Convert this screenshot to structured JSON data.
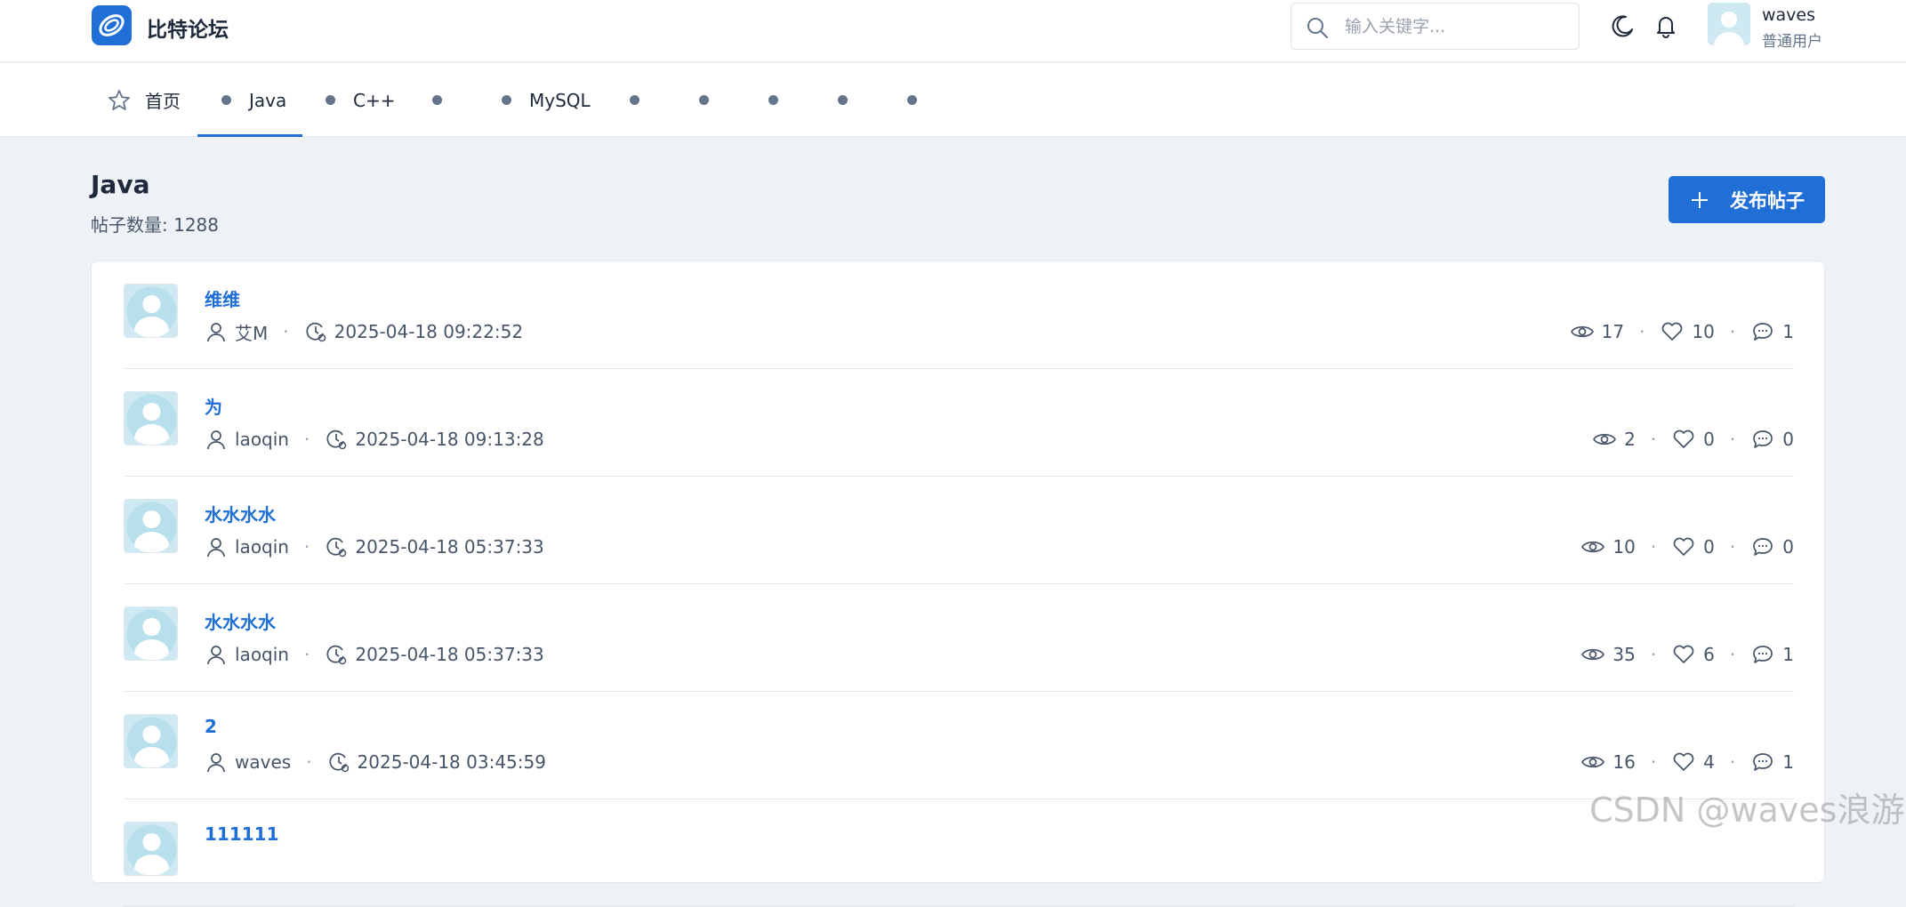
{
  "header": {
    "brand": "比特论坛",
    "search_placeholder": "输入关键字...",
    "user_name": "waves",
    "user_role": "普通用户"
  },
  "tabs": [
    {
      "label": "首页",
      "icon": "star-icon"
    },
    {
      "label": "Java",
      "active": true
    },
    {
      "label": "C++"
    },
    {
      "label": ""
    },
    {
      "label": "MySQL"
    },
    {
      "label": ""
    },
    {
      "label": ""
    },
    {
      "label": ""
    },
    {
      "label": ""
    },
    {
      "label": ""
    }
  ],
  "section": {
    "title": "Java",
    "count_label": "帖子数量: 1288",
    "post_button": "发布帖子"
  },
  "posts": [
    {
      "title": "维维",
      "author": "艾M",
      "time": "2025-04-18 09:22:52",
      "views": "17",
      "likes": "10",
      "comments": "1"
    },
    {
      "title": "为",
      "author": "laoqin",
      "time": "2025-04-18 09:13:28",
      "views": "2",
      "likes": "0",
      "comments": "0"
    },
    {
      "title": "水水水水",
      "author": "laoqin",
      "time": "2025-04-18 05:37:33",
      "views": "10",
      "likes": "0",
      "comments": "0"
    },
    {
      "title": "水水水水",
      "author": "laoqin",
      "time": "2025-04-18 05:37:33",
      "views": "35",
      "likes": "6",
      "comments": "1"
    },
    {
      "title": "2",
      "author": "waves",
      "time": "2025-04-18 03:45:59",
      "views": "16",
      "likes": "4",
      "comments": "1"
    },
    {
      "title": "111111",
      "author": "",
      "time": "",
      "views": "",
      "likes": "",
      "comments": ""
    }
  ],
  "watermark": "CSDN @waves浪游",
  "colors": {
    "accent": "#1f6fd6",
    "page_bg": "#eef2f7",
    "avatar_bg": "#cfe9f2"
  }
}
